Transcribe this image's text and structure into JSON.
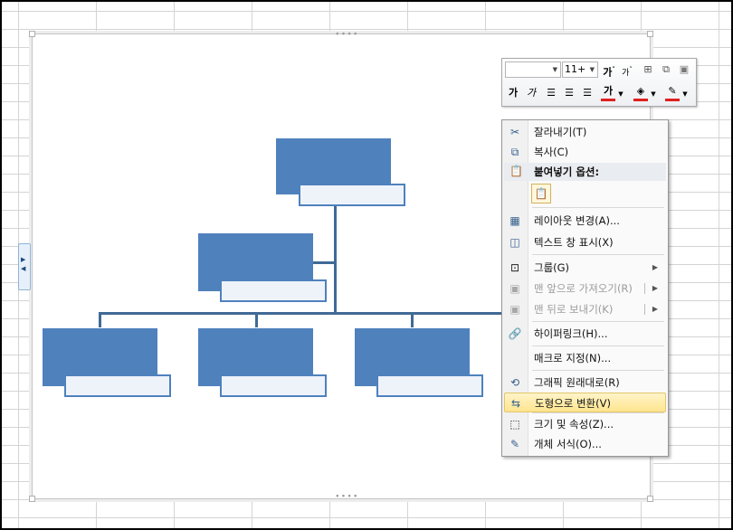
{
  "toolbar": {
    "font_name_value": "",
    "font_size_value": "11+",
    "grow_font_label": "가",
    "grow_font_mark": "˄",
    "shrink_font_label": "가",
    "shrink_font_mark": "˅",
    "bold_label": "가",
    "italic_label": "가",
    "font_color_label": "가",
    "font_color_accent": "#e02020",
    "fill_color_accent": "#e02020",
    "outline_color_accent": "#e02020"
  },
  "context_menu": {
    "items": [
      {
        "label": "잘라내기(T)",
        "icon": "scissors-icon",
        "disabled": false
      },
      {
        "label": "복사(C)",
        "icon": "copy-icon",
        "disabled": false
      },
      {
        "label": "붙여넣기 옵션:",
        "icon": "paste-icon",
        "disabled": false,
        "header": true
      },
      {
        "label": "",
        "icon": "paste-clipboard-icon",
        "disabled": false
      },
      {
        "label": "레이아웃 변경(A)...",
        "icon": "layout-icon",
        "disabled": false
      },
      {
        "label": "텍스트 창 표시(X)",
        "icon": "text-pane-icon",
        "disabled": false
      },
      {
        "label": "그룹(G)",
        "icon": "group-icon",
        "disabled": false,
        "submenu": true
      },
      {
        "label": "맨 앞으로 가져오기(R)",
        "icon": "bring-front-icon",
        "disabled": true,
        "submenu": true
      },
      {
        "label": "맨 뒤로 보내기(K)",
        "icon": "send-back-icon",
        "disabled": true,
        "submenu": true
      },
      {
        "label": "하이퍼링크(H)...",
        "icon": "hyperlink-icon",
        "disabled": false
      },
      {
        "label": "매크로 지정(N)...",
        "icon": "",
        "disabled": false
      },
      {
        "label": "그래픽 원래대로(R)",
        "icon": "reset-graphic-icon",
        "disabled": false
      },
      {
        "label": "도형으로 변환(V)",
        "icon": "convert-shapes-icon",
        "disabled": false,
        "highlighted": true
      },
      {
        "label": "크기 및 속성(Z)...",
        "icon": "size-properties-icon",
        "disabled": false
      },
      {
        "label": "개체 서식(O)...",
        "icon": "format-object-icon",
        "disabled": false
      }
    ]
  },
  "smartart": {
    "box_color": "#4f81bd",
    "connector_color": "#406a96"
  }
}
